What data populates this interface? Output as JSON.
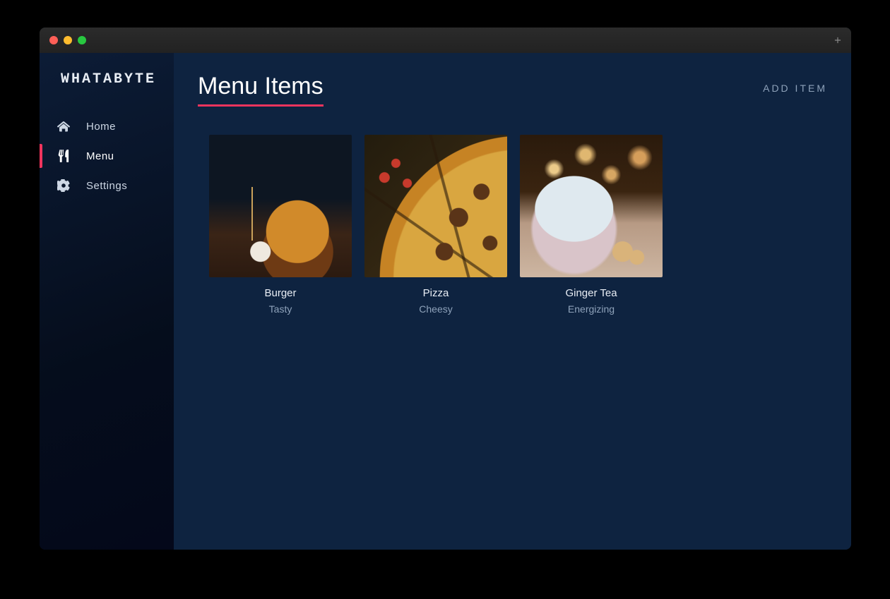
{
  "brand": "WHATABYTE",
  "page_title": "Menu Items",
  "add_button": "ADD ITEM",
  "sidebar": {
    "items": [
      {
        "label": "Home",
        "icon": "home-icon",
        "active": false
      },
      {
        "label": "Menu",
        "icon": "utensils-icon",
        "active": true
      },
      {
        "label": "Settings",
        "icon": "gear-icon",
        "active": false
      }
    ]
  },
  "menu_items": [
    {
      "name": "Burger",
      "description": "Tasty",
      "thumb_style": "burger"
    },
    {
      "name": "Pizza",
      "description": "Cheesy",
      "thumb_style": "pizza"
    },
    {
      "name": "Ginger Tea",
      "description": "Energizing",
      "thumb_style": "tea"
    }
  ]
}
